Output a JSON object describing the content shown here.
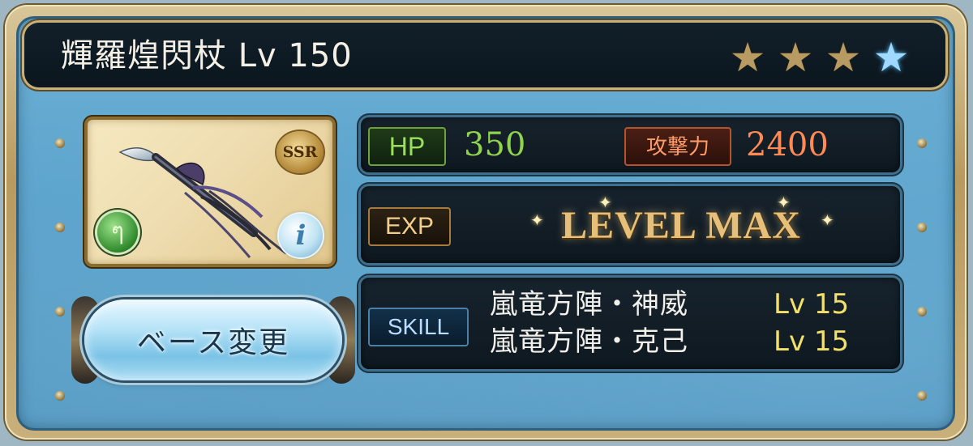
{
  "weapon": {
    "name_level": "輝羅煌閃杖 Lv 150",
    "rarity_badge": "SSR",
    "stars": [
      {
        "filled": true,
        "color": "#b89b62"
      },
      {
        "filled": true,
        "color": "#b89b62"
      },
      {
        "filled": true,
        "color": "#b89b62"
      },
      {
        "filled": true,
        "color": "#9fd9ff"
      }
    ],
    "element_icon": "wind-element-icon",
    "info_icon_glyph": "i"
  },
  "stats": {
    "hp_label": "HP",
    "hp_value": "350",
    "atk_label": "攻撃力",
    "atk_value": "2400"
  },
  "exp": {
    "label": "EXP",
    "status": "LEVEL MAX"
  },
  "skills": {
    "label": "SKILL",
    "items": [
      {
        "name": "嵐竜方陣・神威",
        "level": "Lv 15"
      },
      {
        "name": "嵐竜方陣・克己",
        "level": "Lv 15"
      }
    ]
  },
  "buttons": {
    "change_base": "ベース変更"
  },
  "colors": {
    "panel_blue": "#5aa2cb",
    "gold_frame": "#c7b07a",
    "hp_green": "#8fd44c",
    "atk_orange": "#ff8a54",
    "skill_level_yellow": "#f2e06a"
  }
}
